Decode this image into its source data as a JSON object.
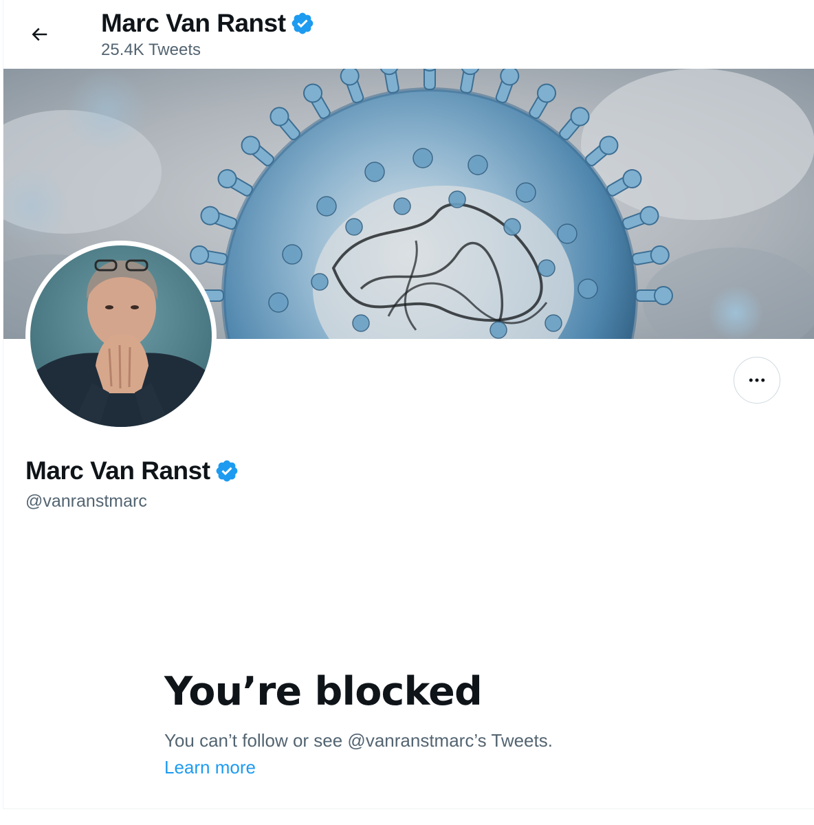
{
  "header": {
    "display_name": "Marc Van Ranst",
    "tweet_count": "25.4K Tweets"
  },
  "profile": {
    "display_name": "Marc Van Ranst",
    "handle": "@vanranstmarc",
    "verified": true
  },
  "blocked_notice": {
    "title": "You’re blocked",
    "message": "You can’t follow or see @vanranstmarc’s Tweets.",
    "link": "Learn more"
  },
  "icons": {
    "back": "arrow-left-icon",
    "verified": "verified-badge-icon",
    "more": "more-dots-icon"
  },
  "colors": {
    "accent": "#1d9bf0",
    "text_primary": "#0f1419",
    "text_secondary": "#536471",
    "border": "#cfd9de"
  }
}
